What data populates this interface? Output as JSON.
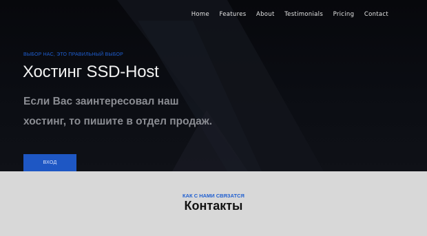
{
  "nav": {
    "items": [
      {
        "label": "Home"
      },
      {
        "label": "Features"
      },
      {
        "label": "About"
      },
      {
        "label": "Testimonials"
      },
      {
        "label": "Pricing"
      },
      {
        "label": "Contact"
      }
    ]
  },
  "hero": {
    "eyebrow": "ВЫБОР НАС, ЭТО ПРАВИЛЬНЫЙ ВЫБОР",
    "title": "Хостинг SSD-Host",
    "text": "Если Вас заинтересовал наш хостинг, то пишите в отдел продаж.",
    "button_label": "ВХОД"
  },
  "contacts": {
    "eyebrow": "КАК С НАМИ СВЯЗАТСЯ",
    "title": "Контакты"
  },
  "colors": {
    "accent": "#1e57c4",
    "hero_bg": "#0b0d13",
    "section_bg": "#d8d8d8"
  }
}
